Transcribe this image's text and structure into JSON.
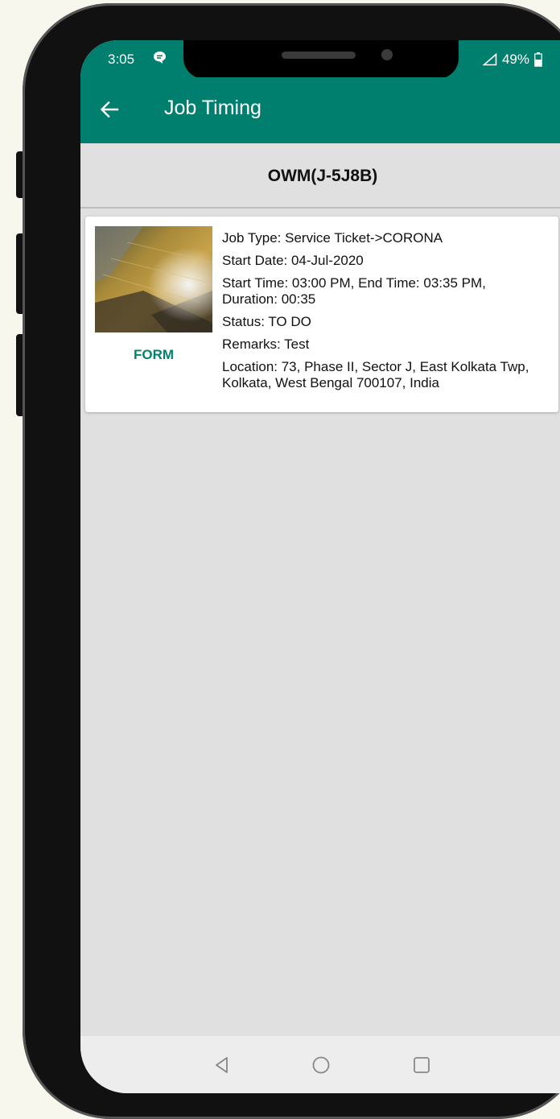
{
  "status_bar": {
    "time": "3:05",
    "battery": "49%"
  },
  "app_bar": {
    "title": "Job Timing"
  },
  "subheader": {
    "job_code": "OWM(J-5J8B)"
  },
  "job_card": {
    "form_label": "FORM",
    "job_type": "Job Type: Service Ticket->CORONA",
    "start_date": "Start Date: 04-Jul-2020",
    "time_range": "Start Time: 03:00 PM, End Time: 03:35 PM,",
    "duration": "Duration: 00:35",
    "status": "Status: TO DO",
    "remarks": "Remarks: Test",
    "location": "Location: 73, Phase II, Sector J, East Kolkata Twp, Kolkata, West Bengal 700107, India"
  },
  "icons": {
    "back": "arrow-left-icon",
    "message": "message-icon",
    "signal": "signal-icon",
    "battery": "battery-icon",
    "nav_back": "triangle-back-icon",
    "nav_home": "circle-home-icon",
    "nav_recent": "square-recent-icon"
  },
  "colors": {
    "primary": "#017f6e",
    "accent": "#02826e",
    "background": "#e0e0e0"
  }
}
